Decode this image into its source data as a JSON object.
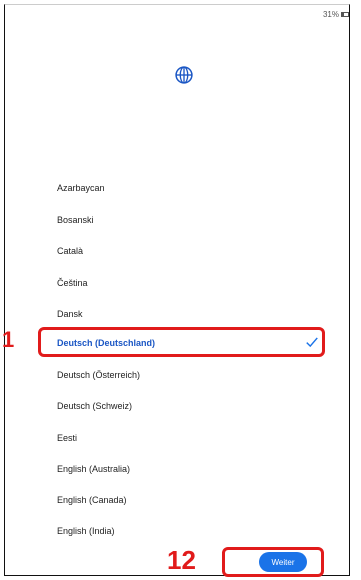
{
  "status": {
    "battery_text": "31%"
  },
  "languages": [
    "Azarbaycan",
    "Bosanski",
    "Català",
    "Čeština",
    "Dansk",
    "Deutsch (Deutschland)",
    "Deutsch (Österreich)",
    "Deutsch (Schweiz)",
    "Eesti",
    "English (Australia)",
    "English (Canada)",
    "English (India)"
  ],
  "selected_index": 5,
  "annotations": {
    "step_1": "1",
    "step_12": "12"
  },
  "buttons": {
    "next_label": "Weiter"
  },
  "colors": {
    "accent": "#1a73e8",
    "selected_text": "#1a56c4",
    "annotation": "#e11b1b"
  },
  "icons": {
    "globe": "globe-icon",
    "check": "check-icon",
    "battery": "battery-icon"
  }
}
